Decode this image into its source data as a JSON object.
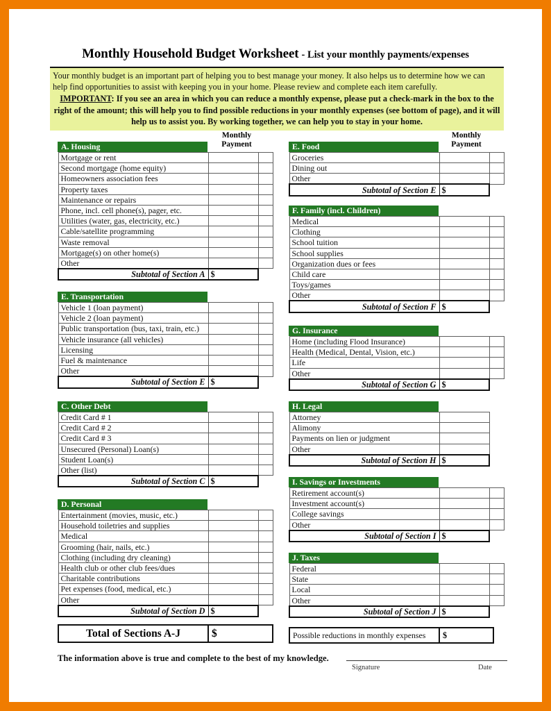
{
  "page": {
    "border_color": "#f07c00",
    "header_green": "#237a24",
    "notice_bg": "#e9f29c"
  },
  "title": {
    "main": "Monthly Household Budget Worksheet",
    "sub": "- List your monthly payments/expenses"
  },
  "notice": {
    "paragraph1": "Your monthly budget is an important part of helping you to best manage your money. It also helps us to determine how we can help find opportunities to assist with keeping you in your home. Please review and complete each item carefully.",
    "important_label": "IMPORTANT",
    "paragraph2": ": If you see an area in which you can reduce a monthly expense, please put a check-mark in the box to the right of the amount; this will help you to find possible reductions in your monthly expenses (see bottom of page), and it will help us to assist you. By working together, we can help you to stay in your home."
  },
  "column_header": {
    "line1": "Monthly",
    "line2": "Payment"
  },
  "sections": {
    "housing": {
      "heading": "A. Housing",
      "items": [
        "Mortgage or rent",
        "Second mortgage (home equity)",
        "Homeowners association fees",
        "Property taxes",
        "Maintenance or repairs",
        "Phone, incl. cell phone(s), pager, etc.",
        "Utilities (water, gas, electricity, etc.)",
        "Cable/satellite programming",
        "Waste removal",
        "Mortgage(s) on other home(s)",
        "Other"
      ],
      "subtotal_label": "Subtotal of Section A",
      "subtotal_value": "$"
    },
    "transportation": {
      "heading": "E. Transportation",
      "items": [
        "Vehicle 1 (loan payment)",
        "Vehicle 2 (loan payment)",
        "Public transportation (bus, taxi, train, etc.)",
        "Vehicle insurance (all vehicles)",
        "Licensing",
        "Fuel & maintenance",
        "Other"
      ],
      "subtotal_label": "Subtotal of Section E",
      "subtotal_value": "$"
    },
    "other_debt": {
      "heading": "C. Other Debt",
      "items": [
        "Credit Card # 1",
        "Credit Card # 2",
        "Credit Card # 3",
        "Unsecured (Personal) Loan(s)",
        "Student Loan(s)",
        "Other (list)"
      ],
      "subtotal_label": "Subtotal of Section C",
      "subtotal_value": "$"
    },
    "personal": {
      "heading": "D. Personal",
      "items": [
        "Entertainment (movies, music, etc.)",
        "Household toiletries and supplies",
        "Medical",
        "Grooming (hair, nails, etc.)",
        "Clothing (including dry cleaning)",
        "Health club or other club fees/dues",
        "Charitable contributions",
        "Pet expenses (food, medical, etc.)",
        "Other"
      ],
      "subtotal_label": "Subtotal of Section D",
      "subtotal_value": "$"
    },
    "food": {
      "heading": "E.  Food",
      "items": [
        "Groceries",
        "Dining out",
        "Other"
      ],
      "subtotal_label": "Subtotal of Section E",
      "subtotal_value": "$"
    },
    "family": {
      "heading": "F. Family (incl. Children)",
      "items": [
        "Medical",
        "Clothing",
        "School tuition",
        "School supplies",
        "Organization dues or fees",
        "Child care",
        "Toys/games",
        "Other"
      ],
      "subtotal_label": "Subtotal of Section F",
      "subtotal_value": "$"
    },
    "insurance": {
      "heading": "G. Insurance",
      "items": [
        "Home (including Flood Insurance)",
        "Health (Medical, Dental, Vision, etc.)",
        "Life",
        "Other"
      ],
      "subtotal_label": "Subtotal of Section G",
      "subtotal_value": "$"
    },
    "legal": {
      "heading": "H. Legal",
      "items": [
        "Attorney",
        "Alimony",
        "Payments on lien or judgment",
        "Other"
      ],
      "subtotal_label": "Subtotal of Section H",
      "subtotal_value": "$"
    },
    "savings": {
      "heading": "I. Savings or Investments",
      "items": [
        "Retirement account(s)",
        "Investment account(s)",
        "College savings",
        "Other"
      ],
      "subtotal_label": "Subtotal of Section I",
      "subtotal_value": "$"
    },
    "taxes": {
      "heading": "J. Taxes",
      "items": [
        "Federal",
        "State",
        "Local",
        "Other"
      ],
      "subtotal_label": "Subtotal of Section J",
      "subtotal_value": "$"
    }
  },
  "totals": {
    "grand_label": "Total of Sections A-J",
    "grand_value": "$",
    "reductions_label": "Possible reductions in monthly expenses",
    "reductions_value": "$"
  },
  "footer": {
    "attestation": "The information above is true and complete to the best of my knowledge.",
    "signature_label": "Signature",
    "date_label": "Date"
  }
}
